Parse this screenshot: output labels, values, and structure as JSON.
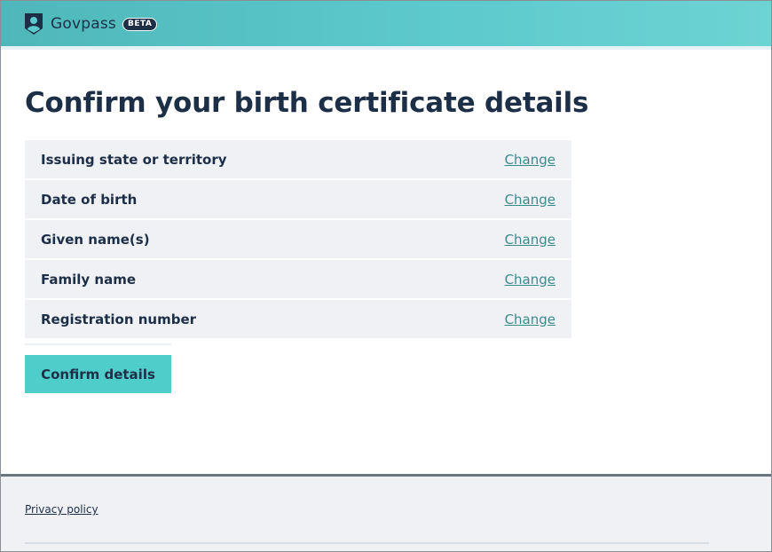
{
  "header": {
    "brand_name": "Govpass",
    "badge": "BETA",
    "logo_icon": "person-shield-icon",
    "colors": {
      "gradient_start": "#4fb7b9",
      "gradient_end": "#6dd3d3"
    }
  },
  "main": {
    "title": "Confirm your birth certificate details",
    "rows": [
      {
        "label": "Issuing state or territory",
        "action": "Change"
      },
      {
        "label": "Date of birth",
        "action": "Change"
      },
      {
        "label": "Given name(s)",
        "action": "Change"
      },
      {
        "label": "Family name",
        "action": "Change"
      },
      {
        "label": "Registration number",
        "action": "Change"
      }
    ],
    "confirm_label": "Confirm details",
    "colors": {
      "button": "#4fcdcb",
      "link": "#3a8b8e",
      "row_bg": "#eff1f5",
      "text": "#1d2f47"
    }
  },
  "footer": {
    "privacy_label": "Privacy policy"
  }
}
